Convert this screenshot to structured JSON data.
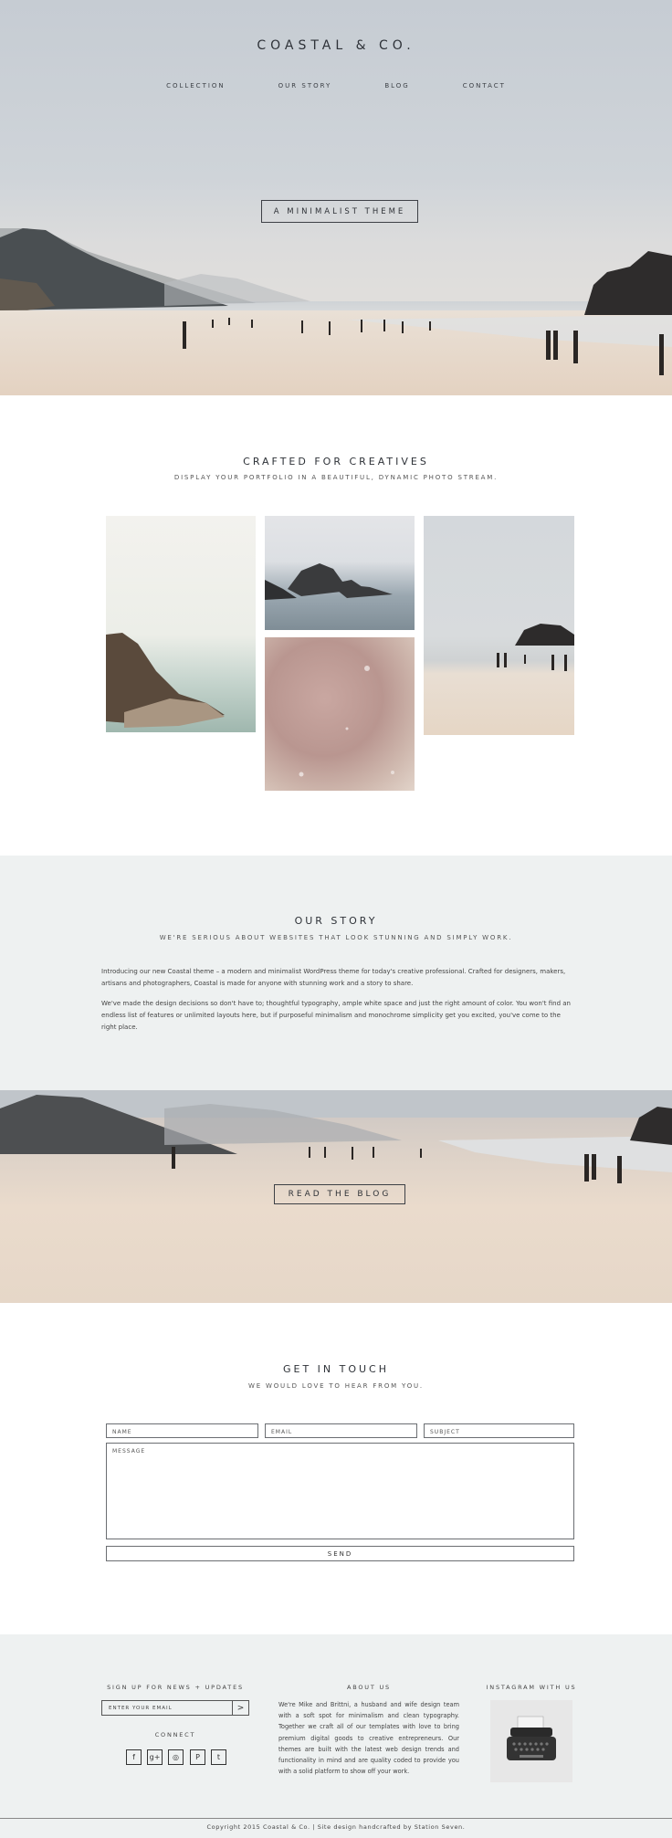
{
  "header": {
    "brand": "COASTAL & CO.",
    "nav": [
      "COLLECTION",
      "OUR STORY",
      "BLOG",
      "CONTACT"
    ],
    "hero_button": "A MINIMALIST THEME"
  },
  "portfolio": {
    "title": "CRAFTED FOR CREATIVES",
    "subtitle": "DISPLAY YOUR PORTFOLIO IN A BEAUTIFUL, DYNAMIC PHOTO STREAM."
  },
  "story": {
    "title": "OUR STORY",
    "subtitle": "WE'RE SERIOUS ABOUT WEBSITES THAT LOOK STUNNING AND SIMPLY WORK.",
    "paragraph1": "Introducing our new Coastal theme – a modern and minimalist WordPress theme for today's creative professional. Crafted for designers, makers, artisans and photographers, Coastal is made for anyone with stunning work and a story to share.",
    "paragraph2": "We've made the design decisions so don't have to; thoughtful typography, ample white space and just the right amount of color. You won't find an endless list of features or unlimited layouts here, but if purposeful minimalism and monochrome simplicity get you excited, you've come to the right place."
  },
  "blog": {
    "button": "READ THE BLOG"
  },
  "contact": {
    "title": "GET IN TOUCH",
    "subtitle": "WE WOULD LOVE TO HEAR FROM YOU.",
    "name_placeholder": "NAME",
    "email_placeholder": "EMAIL",
    "subject_placeholder": "SUBJECT",
    "message_placeholder": "MESSAGE",
    "send": "SEND"
  },
  "footer": {
    "signup_title": "SIGN UP FOR NEWS + UPDATES",
    "email_placeholder": "ENTER YOUR EMAIL",
    "submit_glyph": ">",
    "connect_title": "CONNECT",
    "social": [
      "f",
      "g+",
      "◎",
      "P",
      "t"
    ],
    "social_icons": [
      "facebook-icon",
      "google-plus-icon",
      "instagram-icon",
      "pinterest-icon",
      "twitter-icon"
    ],
    "about_title": "ABOUT US",
    "about_text": "We're Mike and Brittni, a husband and wife design team with a soft spot for minimalism and clean typography. Together we craft all of our templates with love to bring premium digital goods to creative entrepreneurs. Our themes are built with the latest web design trends and functionality in mind and are quality coded to provide you with a solid platform to show off your work.",
    "instagram_title": "INSTAGRAM WITH US",
    "copyright": "Copyright 2015 Coastal & Co. | Site design handcrafted by Station Seven."
  },
  "colors": {
    "text": "#2e3238",
    "section_bg": "#eef1f1",
    "sand": "#e8dacb"
  }
}
